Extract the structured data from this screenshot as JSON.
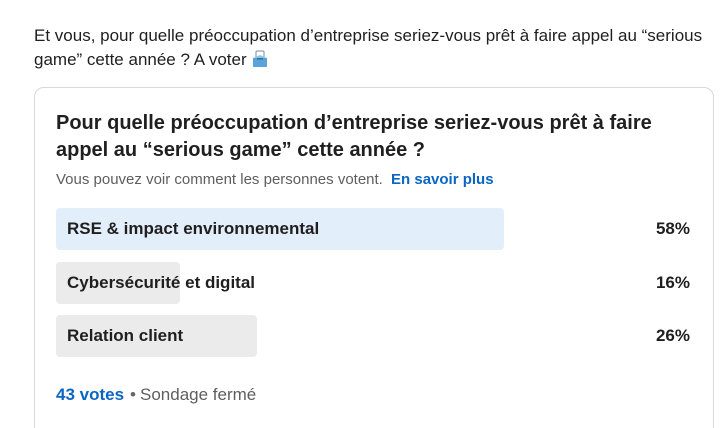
{
  "post": {
    "text": "Et vous, pour quelle préoccupation d’entreprise seriez-vous prêt à faire appel au “serious game” cette année ? A voter",
    "trailing_icon": "ballot-box-icon"
  },
  "poll": {
    "question": "Pour quelle préoccupation d’entreprise seriez-vous prêt à faire appel au “serious game” cette année ?",
    "notice": "Vous pouvez voir comment les personnes votent.",
    "learn_more": "En savoir plus",
    "options": [
      {
        "label": "RSE & impact environnemental",
        "percent_text": "58%",
        "percent": 58,
        "fill_color": "#e3eefb"
      },
      {
        "label": "Cybersécurité et digital",
        "percent_text": "16%",
        "percent": 16,
        "fill_color": "#ebebeb"
      },
      {
        "label": "Relation client",
        "percent_text": "26%",
        "percent": 26,
        "fill_color": "#ebebeb"
      }
    ],
    "votes": "43 votes",
    "separator": "•",
    "status": "Sondage fermé"
  }
}
